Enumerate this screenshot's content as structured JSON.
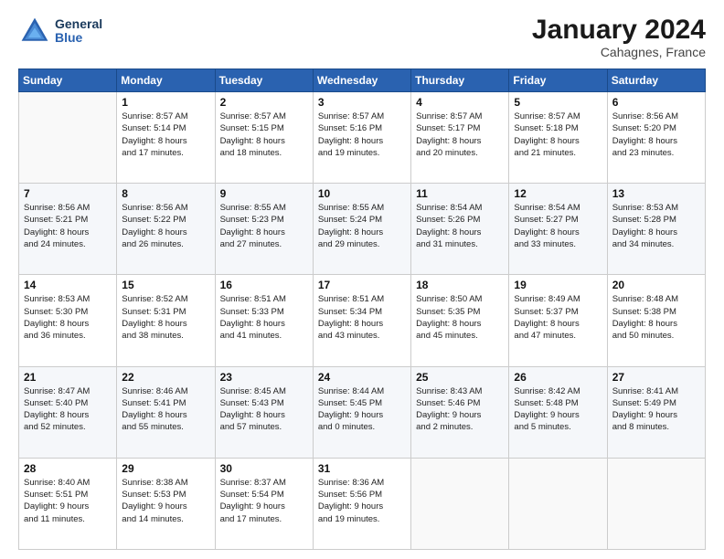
{
  "header": {
    "logo_general": "General",
    "logo_blue": "Blue",
    "title": "January 2024",
    "subtitle": "Cahagnes, France"
  },
  "weekdays": [
    "Sunday",
    "Monday",
    "Tuesday",
    "Wednesday",
    "Thursday",
    "Friday",
    "Saturday"
  ],
  "weeks": [
    [
      {
        "day": "",
        "info": ""
      },
      {
        "day": "1",
        "info": "Sunrise: 8:57 AM\nSunset: 5:14 PM\nDaylight: 8 hours\nand 17 minutes."
      },
      {
        "day": "2",
        "info": "Sunrise: 8:57 AM\nSunset: 5:15 PM\nDaylight: 8 hours\nand 18 minutes."
      },
      {
        "day": "3",
        "info": "Sunrise: 8:57 AM\nSunset: 5:16 PM\nDaylight: 8 hours\nand 19 minutes."
      },
      {
        "day": "4",
        "info": "Sunrise: 8:57 AM\nSunset: 5:17 PM\nDaylight: 8 hours\nand 20 minutes."
      },
      {
        "day": "5",
        "info": "Sunrise: 8:57 AM\nSunset: 5:18 PM\nDaylight: 8 hours\nand 21 minutes."
      },
      {
        "day": "6",
        "info": "Sunrise: 8:56 AM\nSunset: 5:20 PM\nDaylight: 8 hours\nand 23 minutes."
      }
    ],
    [
      {
        "day": "7",
        "info": "Sunrise: 8:56 AM\nSunset: 5:21 PM\nDaylight: 8 hours\nand 24 minutes."
      },
      {
        "day": "8",
        "info": "Sunrise: 8:56 AM\nSunset: 5:22 PM\nDaylight: 8 hours\nand 26 minutes."
      },
      {
        "day": "9",
        "info": "Sunrise: 8:55 AM\nSunset: 5:23 PM\nDaylight: 8 hours\nand 27 minutes."
      },
      {
        "day": "10",
        "info": "Sunrise: 8:55 AM\nSunset: 5:24 PM\nDaylight: 8 hours\nand 29 minutes."
      },
      {
        "day": "11",
        "info": "Sunrise: 8:54 AM\nSunset: 5:26 PM\nDaylight: 8 hours\nand 31 minutes."
      },
      {
        "day": "12",
        "info": "Sunrise: 8:54 AM\nSunset: 5:27 PM\nDaylight: 8 hours\nand 33 minutes."
      },
      {
        "day": "13",
        "info": "Sunrise: 8:53 AM\nSunset: 5:28 PM\nDaylight: 8 hours\nand 34 minutes."
      }
    ],
    [
      {
        "day": "14",
        "info": "Sunrise: 8:53 AM\nSunset: 5:30 PM\nDaylight: 8 hours\nand 36 minutes."
      },
      {
        "day": "15",
        "info": "Sunrise: 8:52 AM\nSunset: 5:31 PM\nDaylight: 8 hours\nand 38 minutes."
      },
      {
        "day": "16",
        "info": "Sunrise: 8:51 AM\nSunset: 5:33 PM\nDaylight: 8 hours\nand 41 minutes."
      },
      {
        "day": "17",
        "info": "Sunrise: 8:51 AM\nSunset: 5:34 PM\nDaylight: 8 hours\nand 43 minutes."
      },
      {
        "day": "18",
        "info": "Sunrise: 8:50 AM\nSunset: 5:35 PM\nDaylight: 8 hours\nand 45 minutes."
      },
      {
        "day": "19",
        "info": "Sunrise: 8:49 AM\nSunset: 5:37 PM\nDaylight: 8 hours\nand 47 minutes."
      },
      {
        "day": "20",
        "info": "Sunrise: 8:48 AM\nSunset: 5:38 PM\nDaylight: 8 hours\nand 50 minutes."
      }
    ],
    [
      {
        "day": "21",
        "info": "Sunrise: 8:47 AM\nSunset: 5:40 PM\nDaylight: 8 hours\nand 52 minutes."
      },
      {
        "day": "22",
        "info": "Sunrise: 8:46 AM\nSunset: 5:41 PM\nDaylight: 8 hours\nand 55 minutes."
      },
      {
        "day": "23",
        "info": "Sunrise: 8:45 AM\nSunset: 5:43 PM\nDaylight: 8 hours\nand 57 minutes."
      },
      {
        "day": "24",
        "info": "Sunrise: 8:44 AM\nSunset: 5:45 PM\nDaylight: 9 hours\nand 0 minutes."
      },
      {
        "day": "25",
        "info": "Sunrise: 8:43 AM\nSunset: 5:46 PM\nDaylight: 9 hours\nand 2 minutes."
      },
      {
        "day": "26",
        "info": "Sunrise: 8:42 AM\nSunset: 5:48 PM\nDaylight: 9 hours\nand 5 minutes."
      },
      {
        "day": "27",
        "info": "Sunrise: 8:41 AM\nSunset: 5:49 PM\nDaylight: 9 hours\nand 8 minutes."
      }
    ],
    [
      {
        "day": "28",
        "info": "Sunrise: 8:40 AM\nSunset: 5:51 PM\nDaylight: 9 hours\nand 11 minutes."
      },
      {
        "day": "29",
        "info": "Sunrise: 8:38 AM\nSunset: 5:53 PM\nDaylight: 9 hours\nand 14 minutes."
      },
      {
        "day": "30",
        "info": "Sunrise: 8:37 AM\nSunset: 5:54 PM\nDaylight: 9 hours\nand 17 minutes."
      },
      {
        "day": "31",
        "info": "Sunrise: 8:36 AM\nSunset: 5:56 PM\nDaylight: 9 hours\nand 19 minutes."
      },
      {
        "day": "",
        "info": ""
      },
      {
        "day": "",
        "info": ""
      },
      {
        "day": "",
        "info": ""
      }
    ]
  ]
}
